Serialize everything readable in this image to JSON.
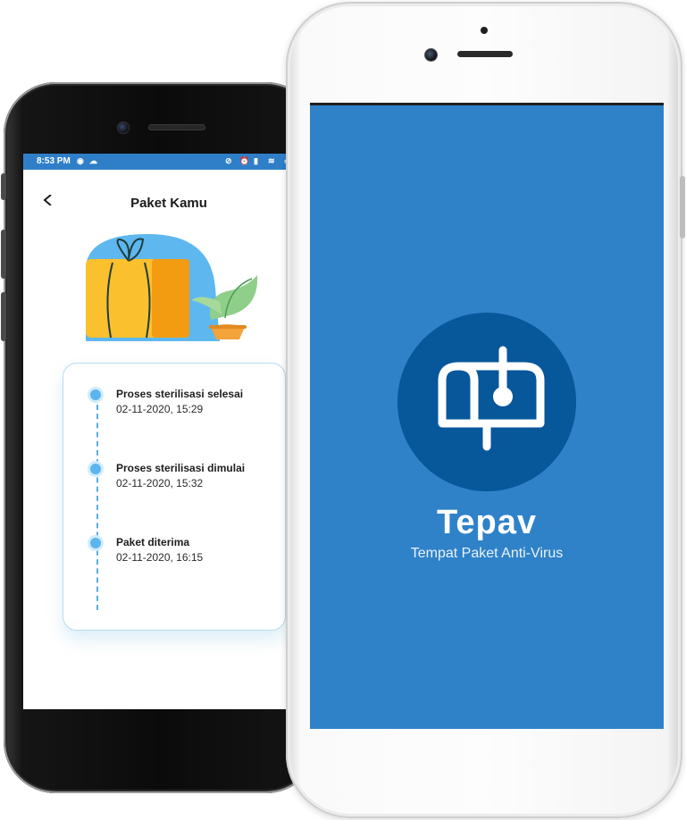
{
  "left_phone": {
    "status_bar": {
      "time": "8:53 PM"
    },
    "header": {
      "title": "Paket Kamu"
    },
    "timeline": [
      {
        "title": "Proses sterilisasi selesai",
        "datetime": "02-11-2020, 15:29"
      },
      {
        "title": "Proses sterilisasi dimulai",
        "datetime": "02-11-2020, 15:32"
      },
      {
        "title": "Paket diterima",
        "datetime": "02-11-2020, 16:15"
      }
    ]
  },
  "right_phone": {
    "splash": {
      "app_name": "Tepav",
      "tagline": "Tempat Paket Anti-Virus",
      "logo_icon": "mailbox-icon"
    }
  },
  "colors": {
    "primary_blue": "#2f82c8",
    "logo_circle": "#07579b",
    "status_bar": "#2f7fc8",
    "timeline_accent": "#5cb6ee"
  }
}
